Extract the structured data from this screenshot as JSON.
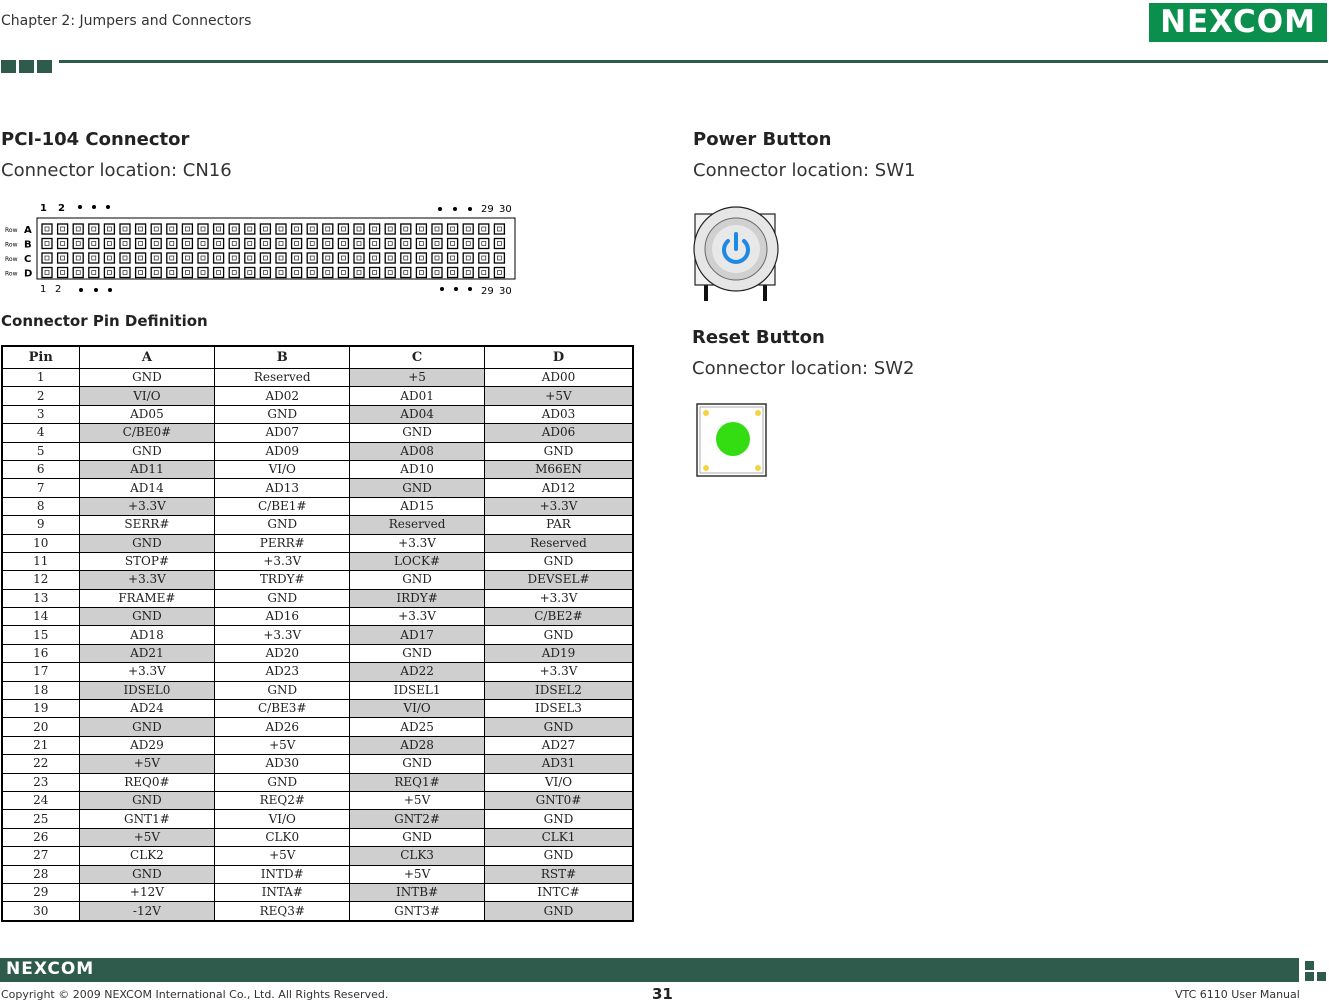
{
  "header": {
    "chapter": "Chapter 2: Jumpers and Connectors",
    "logo": "NEXCOM"
  },
  "pci": {
    "title": "PCI-104 Connector",
    "location": "Connector location: CN16",
    "diagram": {
      "top_pins": [
        "1",
        "2",
        "29",
        "30"
      ],
      "bottom_pins": [
        "1",
        "2",
        "29",
        "30"
      ],
      "row_prefix": "Row",
      "rows": [
        "A",
        "B",
        "C",
        "D"
      ]
    },
    "pin_def_title": "Connector Pin Definition",
    "table": {
      "headers": [
        "Pin",
        "A",
        "B",
        "C",
        "D"
      ],
      "rows": [
        [
          "1",
          "GND",
          "Reserved",
          "+5",
          "AD00"
        ],
        [
          "2",
          "VI/O",
          "AD02",
          "AD01",
          "+5V"
        ],
        [
          "3",
          "AD05",
          "GND",
          "AD04",
          "AD03"
        ],
        [
          "4",
          "C/BE0#",
          "AD07",
          "GND",
          "AD06"
        ],
        [
          "5",
          "GND",
          "AD09",
          "AD08",
          "GND"
        ],
        [
          "6",
          "AD11",
          "VI/O",
          "AD10",
          "M66EN"
        ],
        [
          "7",
          "AD14",
          "AD13",
          "GND",
          "AD12"
        ],
        [
          "8",
          "+3.3V",
          "C/BE1#",
          "AD15",
          "+3.3V"
        ],
        [
          "9",
          "SERR#",
          "GND",
          "Reserved",
          "PAR"
        ],
        [
          "10",
          "GND",
          "PERR#",
          "+3.3V",
          "Reserved"
        ],
        [
          "11",
          "STOP#",
          "+3.3V",
          "LOCK#",
          "GND"
        ],
        [
          "12",
          "+3.3V",
          "TRDY#",
          "GND",
          "DEVSEL#"
        ],
        [
          "13",
          "FRAME#",
          "GND",
          "IRDY#",
          "+3.3V"
        ],
        [
          "14",
          "GND",
          "AD16",
          "+3.3V",
          "C/BE2#"
        ],
        [
          "15",
          "AD18",
          "+3.3V",
          "AD17",
          "GND"
        ],
        [
          "16",
          "AD21",
          "AD20",
          "GND",
          "AD19"
        ],
        [
          "17",
          "+3.3V",
          "AD23",
          "AD22",
          "+3.3V"
        ],
        [
          "18",
          "IDSEL0",
          "GND",
          "IDSEL1",
          "IDSEL2"
        ],
        [
          "19",
          "AD24",
          "C/BE3#",
          "VI/O",
          "IDSEL3"
        ],
        [
          "20",
          "GND",
          "AD26",
          "AD25",
          "GND"
        ],
        [
          "21",
          "AD29",
          "+5V",
          "AD28",
          "AD27"
        ],
        [
          "22",
          "+5V",
          "AD30",
          "GND",
          "AD31"
        ],
        [
          "23",
          "REQ0#",
          "GND",
          "REQ1#",
          "VI/O"
        ],
        [
          "24",
          "GND",
          "REQ2#",
          "+5V",
          "GNT0#"
        ],
        [
          "25",
          "GNT1#",
          "VI/O",
          "GNT2#",
          "GND"
        ],
        [
          "26",
          "+5V",
          "CLK0",
          "GND",
          "CLK1"
        ],
        [
          "27",
          "CLK2",
          "+5V",
          "CLK3",
          "GND"
        ],
        [
          "28",
          "GND",
          "INTD#",
          "+5V",
          "RST#"
        ],
        [
          "29",
          "+12V",
          "INTA#",
          "INTB#",
          "INTC#"
        ],
        [
          "30",
          "-12V",
          "REQ3#",
          "GNT3#",
          "GND"
        ]
      ]
    }
  },
  "power": {
    "title": "Power Button",
    "location": "Connector location: SW1"
  },
  "reset": {
    "title": "Reset Button",
    "location": "Connector location: SW2"
  },
  "footer": {
    "logo": "NEXCOM",
    "copyright": "Copyright © 2009 NEXCOM International Co., Ltd. All Rights Reserved.",
    "page": "31",
    "manual": "VTC 6110 User Manual"
  },
  "colors": {
    "brand_green": "#0a8f4c",
    "bar_green": "#2f5b4d",
    "shade": "#cfcfcf",
    "power_blue": "#1e88e5",
    "reset_green": "#33dd11"
  }
}
